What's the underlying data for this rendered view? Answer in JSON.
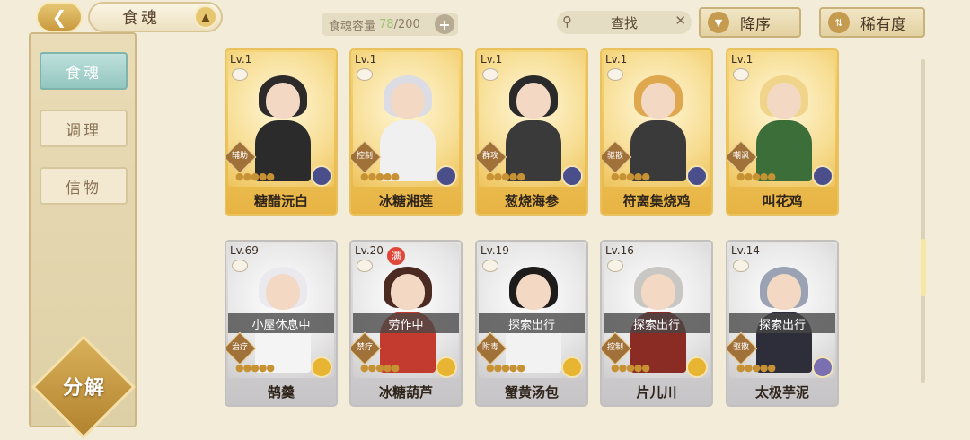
{
  "header": {
    "back_icon": "back-arrow-icon",
    "title": "食魂",
    "title_icon": "pagoda-icon",
    "capacity_label": "食魂容量",
    "capacity_count": "78",
    "capacity_total": "/200",
    "add_label": "+",
    "search_label": "查找",
    "sort_label": "降序",
    "rarity_label": "稀有度"
  },
  "sidebar": {
    "items": [
      {
        "label": "食魂",
        "active": true
      },
      {
        "label": "调理",
        "active": false
      },
      {
        "label": "信物",
        "active": false
      }
    ],
    "decompose_label": "分解"
  },
  "cards": [
    {
      "level": "Lv.1",
      "name": "糖醋沅白",
      "role": "辅助",
      "stars": 5,
      "frame": "gold",
      "element_color": "#4a4f8c",
      "hair": "#2d2a2a",
      "body": "#2b2b2b",
      "status": ""
    },
    {
      "level": "Lv.1",
      "name": "冰糖湘莲",
      "role": "控制",
      "stars": 5,
      "frame": "gold",
      "element_color": "#4a4f8c",
      "hair": "#dcdde4",
      "body": "#f0f0f0",
      "status": ""
    },
    {
      "level": "Lv.1",
      "name": "葱烧海参",
      "role": "群攻",
      "stars": 5,
      "frame": "gold",
      "element_color": "#4a4f8c",
      "hair": "#2a2a2a",
      "body": "#3a3a3a",
      "status": ""
    },
    {
      "level": "Lv.1",
      "name": "符离集烧鸡",
      "role": "驱散",
      "stars": 5,
      "frame": "gold",
      "element_color": "#4a4f8c",
      "hair": "#e0a84e",
      "body": "#3a3a3a",
      "status": ""
    },
    {
      "level": "Lv.1",
      "name": "叫花鸡",
      "role": "嘲讽",
      "stars": 5,
      "frame": "gold",
      "element_color": "#4a4f8c",
      "hair": "#f0d48a",
      "body": "#3c6e3a",
      "status": ""
    },
    {
      "level": "Lv.69",
      "name": "鹄羹",
      "role": "治疗",
      "stars": 5,
      "frame": "silver",
      "element_color": "#e7b531",
      "hair": "#e9e9ee",
      "body": "#f4f4f4",
      "status": "小屋休息中"
    },
    {
      "level": "Lv.20",
      "name": "冰糖葫芦",
      "role": "禁疗",
      "stars": 5,
      "frame": "silver",
      "element_color": "#e7b531",
      "hair": "#4b2a22",
      "body": "#c33b2e",
      "status": "劳作中",
      "badge": "满"
    },
    {
      "level": "Lv.19",
      "name": "蟹黄汤包",
      "role": "附毒",
      "stars": 5,
      "frame": "silver",
      "element_color": "#e7b531",
      "hair": "#1e1b1b",
      "body": "#f2f2f2",
      "status": "探索出行"
    },
    {
      "level": "Lv.16",
      "name": "片儿川",
      "role": "控制",
      "stars": 5,
      "frame": "silver",
      "element_color": "#e7b531",
      "hair": "#c8c7c4",
      "body": "#8a2c24",
      "status": "探索出行"
    },
    {
      "level": "Lv.14",
      "name": "太极芋泥",
      "role": "驱散",
      "stars": 5,
      "frame": "silver",
      "element_color": "#7a6fb0",
      "hair": "#9aa2b4",
      "body": "#2e2e3a",
      "status": "探索出行"
    }
  ]
}
